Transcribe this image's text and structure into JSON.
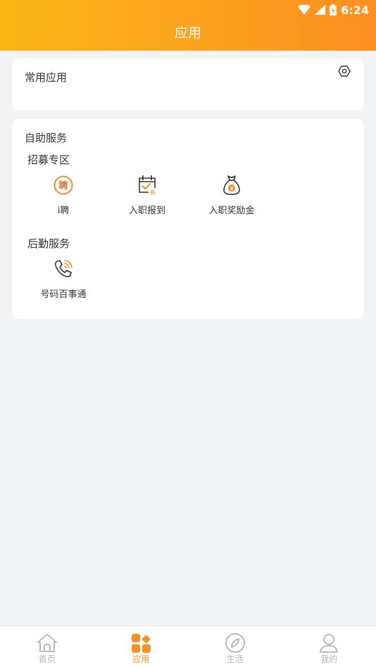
{
  "status_bar": {
    "time": "6:24"
  },
  "header": {
    "title": "应用"
  },
  "common_apps": {
    "title": "常用应用"
  },
  "self_service": {
    "title": "自助服务",
    "groups": [
      {
        "title": "招募专区",
        "apps": [
          {
            "label": "i聘",
            "icon": "pin-recruit-icon",
            "glyph": "聘"
          },
          {
            "label": "入职报到",
            "icon": "calendar-check-icon",
            "badge": "新"
          },
          {
            "label": "入职奖励金",
            "icon": "money-bag-icon",
            "glyph": "¥"
          }
        ]
      },
      {
        "title": "后勤服务",
        "apps": [
          {
            "label": "号码百事通",
            "icon": "phone-call-icon"
          }
        ]
      }
    ]
  },
  "tabbar": {
    "items": [
      {
        "label": "首页",
        "icon": "home-icon",
        "active": false
      },
      {
        "label": "应用",
        "icon": "apps-grid-icon",
        "active": true
      },
      {
        "label": "生活",
        "icon": "compass-icon",
        "active": false
      },
      {
        "label": "我的",
        "icon": "user-icon",
        "active": false
      }
    ]
  },
  "colors": {
    "accent": "#fd8f23",
    "header_start": "#fbb616",
    "header_end": "#fd8f23",
    "background": "#f2f3f5",
    "inactive": "#b3b3b3"
  }
}
